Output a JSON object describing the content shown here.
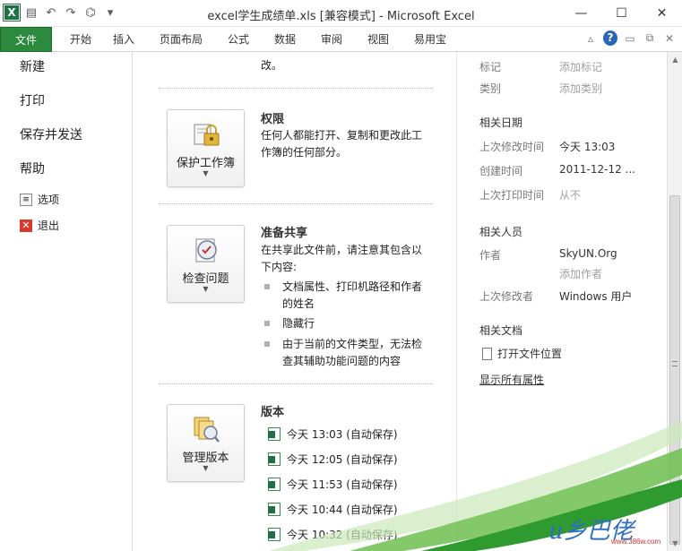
{
  "window": {
    "title": "excel学生成绩单.xls  [兼容模式]  -  Microsoft Excel",
    "app_icon_label": "X",
    "minimize": "—",
    "maximize": "☐",
    "close": "✕"
  },
  "ribbon": {
    "tabs": [
      "文件",
      "开始",
      "插入",
      "页面布局",
      "公式",
      "数据",
      "审阅",
      "视图",
      "易用宝"
    ],
    "help": "?"
  },
  "leftnav": {
    "items": [
      "新建",
      "打印",
      "保存并发送",
      "帮助"
    ],
    "options": "选项",
    "exit": "退出"
  },
  "middle": {
    "top_snippet": "改。",
    "permissions": {
      "button": "保护工作簿",
      "title": "权限",
      "text": "任何人都能打开、复制和更改此工作簿的任何部分。"
    },
    "share": {
      "button": "检查问题",
      "title": "准备共享",
      "text": "在共享此文件前，请注意其包含以下内容:",
      "bullets": [
        "文档属性、打印机路径和作者的姓名",
        "隐藏行",
        "由于当前的文件类型，无法检查其辅助功能问题的内容"
      ]
    },
    "versions": {
      "button": "管理版本",
      "title": "版本",
      "items": [
        "今天 13:03 (自动保存)",
        "今天 12:05 (自动保存)",
        "今天 11:53 (自动保存)",
        "今天 10:44 (自动保存)",
        "今天 10:32 (自动保存)"
      ]
    }
  },
  "right": {
    "tags_label": "标记",
    "tags_value": "添加标记",
    "category_label": "类别",
    "category_value": "添加类别",
    "dates_head": "相关日期",
    "modified_label": "上次修改时间",
    "modified_value": "今天 13:03",
    "created_label": "创建时间",
    "created_value": "2011-12-12 ...",
    "printed_label": "上次打印时间",
    "printed_value": "从不",
    "people_head": "相关人员",
    "author_label": "作者",
    "author_value": "SkyUN.Org",
    "add_author": "添加作者",
    "lastmod_label": "上次修改者",
    "lastmod_value": "Windows 用户",
    "docs_head": "相关文档",
    "open_location": "打开文件位置",
    "show_all": "显示所有属性"
  },
  "watermark": {
    "text": "u乡巴佬",
    "small": "www.386w.com"
  }
}
